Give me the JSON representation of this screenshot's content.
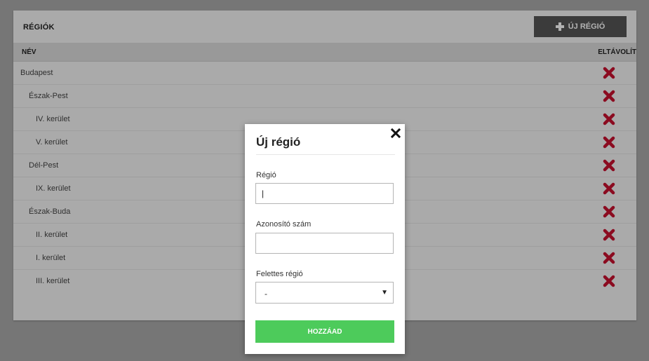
{
  "panel": {
    "title": "RÉGIÓK",
    "add_button_label": "ÚJ RÉGIÓ",
    "columns": {
      "name": "NÉV",
      "remove": "ELTÁVOLÍT"
    },
    "rows": [
      {
        "label": "Budapest",
        "level": 0
      },
      {
        "label": "Észak-Pest",
        "level": 1
      },
      {
        "label": "IV. kerület",
        "level": 2
      },
      {
        "label": "V. kerület",
        "level": 2
      },
      {
        "label": "Dél-Pest",
        "level": 1
      },
      {
        "label": "IX. kerület",
        "level": 2
      },
      {
        "label": "Észak-Buda",
        "level": 1
      },
      {
        "label": "II. kerület",
        "level": 2
      },
      {
        "label": "I. kerület",
        "level": 2
      },
      {
        "label": "III. kerület",
        "level": 2
      }
    ]
  },
  "modal": {
    "title": "Új régió",
    "region_label": "Régió",
    "region_value": "|",
    "id_label": "Azonosító szám",
    "id_value": "",
    "parent_label": "Felettes régió",
    "parent_selected": "-",
    "submit_label": "HOZZÁAD"
  },
  "colors": {
    "remove_icon": "#c8102e",
    "submit_button": "#4dcb5b",
    "add_button": "#555555"
  },
  "icons": {
    "add": "plus-icon",
    "remove": "remove-x-icon",
    "close": "close-icon",
    "select": "chevron-down-icon"
  }
}
